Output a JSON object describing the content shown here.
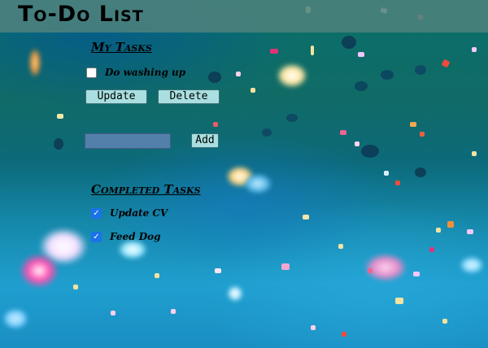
{
  "app": {
    "title": "To-Do List"
  },
  "my_tasks": {
    "heading": "My Tasks",
    "items": [
      {
        "label": "Do washing up",
        "checked": false
      }
    ],
    "update_label": "Update",
    "delete_label": "Delete"
  },
  "add_task": {
    "input_value": "",
    "add_label": "Add"
  },
  "completed": {
    "heading": "Completed Tasks",
    "items": [
      {
        "label": "Update CV",
        "checked": true
      },
      {
        "label": "Feed Dog",
        "checked": true
      }
    ]
  },
  "colors": {
    "header_bg": "#50827d",
    "button_bg": "#a9dfe0",
    "checkbox_checked": "#1a73e8"
  },
  "icons": {
    "checked": "checkmark-icon"
  }
}
